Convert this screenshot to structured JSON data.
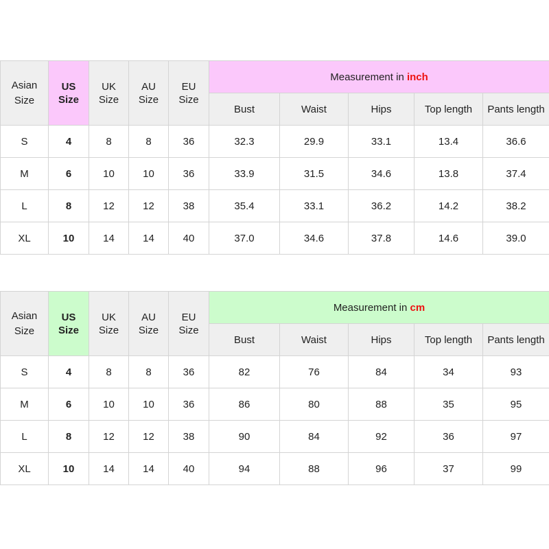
{
  "tables": [
    {
      "header": {
        "asian": [
          "Asian",
          "Size"
        ],
        "us": [
          "US",
          "Size"
        ],
        "uk": [
          "UK",
          "Size"
        ],
        "au": [
          "AU",
          "Size"
        ],
        "eu": [
          "EU",
          "Size"
        ],
        "measurement_prefix": "Measurement in ",
        "measurement_unit": "inch"
      },
      "columns": [
        "Bust",
        "Waist",
        "Hips",
        "Top length",
        "Pants length"
      ],
      "rows": [
        [
          "S",
          "4",
          "8",
          "8",
          "36",
          "32.3",
          "29.9",
          "33.1",
          "13.4",
          "36.6"
        ],
        [
          "M",
          "6",
          "10",
          "10",
          "36",
          "33.9",
          "31.5",
          "34.6",
          "13.8",
          "37.4"
        ],
        [
          "L",
          "8",
          "12",
          "12",
          "38",
          "35.4",
          "33.1",
          "36.2",
          "14.2",
          "38.2"
        ],
        [
          "XL",
          "10",
          "14",
          "14",
          "40",
          "37.0",
          "34.6",
          "37.8",
          "14.6",
          "39.0"
        ]
      ],
      "accent_color": "#fbc8fb"
    },
    {
      "header": {
        "asian": [
          "Asian",
          "Size"
        ],
        "us": [
          "US",
          "Size"
        ],
        "uk": [
          "UK",
          "Size"
        ],
        "au": [
          "AU",
          "Size"
        ],
        "eu": [
          "EU",
          "Size"
        ],
        "measurement_prefix": "Measurement in ",
        "measurement_unit": "cm"
      },
      "columns": [
        "Bust",
        "Waist",
        "Hips",
        "Top length",
        "Pants length"
      ],
      "rows": [
        [
          "S",
          "4",
          "8",
          "8",
          "36",
          "82",
          "76",
          "84",
          "34",
          "93"
        ],
        [
          "M",
          "6",
          "10",
          "10",
          "36",
          "86",
          "80",
          "88",
          "35",
          "95"
        ],
        [
          "L",
          "8",
          "12",
          "12",
          "38",
          "90",
          "84",
          "92",
          "36",
          "97"
        ],
        [
          "XL",
          "10",
          "14",
          "14",
          "40",
          "94",
          "88",
          "96",
          "37",
          "99"
        ]
      ],
      "accent_color": "#ccfccc"
    }
  ],
  "unit_color": "#ee1111"
}
